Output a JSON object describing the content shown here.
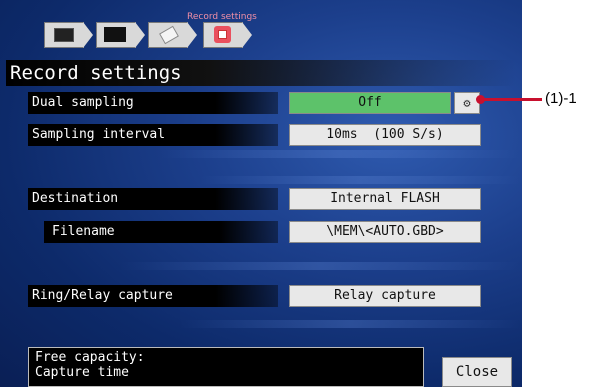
{
  "breadcrumb": {
    "current_label": "Record settings"
  },
  "title": "Record settings",
  "rows": {
    "dual_sampling": {
      "label": "Dual sampling",
      "value": "Off"
    },
    "sampling_interval": {
      "label": "Sampling interval",
      "value": "10ms  (100 S/s)"
    },
    "destination": {
      "label": "Destination",
      "value": "Internal FLASH"
    },
    "filename": {
      "label": "Filename",
      "value": "\\MEM\\<AUTO.GBD>"
    },
    "ring_relay": {
      "label": "Ring/Relay capture",
      "value": "Relay capture"
    }
  },
  "info": {
    "line1": "Free capacity:",
    "line2": "Capture time"
  },
  "close_label": "Close",
  "callout": "(1)-1",
  "colors": {
    "active_button": "#5dc26a",
    "background": "#1c3f8c",
    "callout": "#c8102e"
  }
}
